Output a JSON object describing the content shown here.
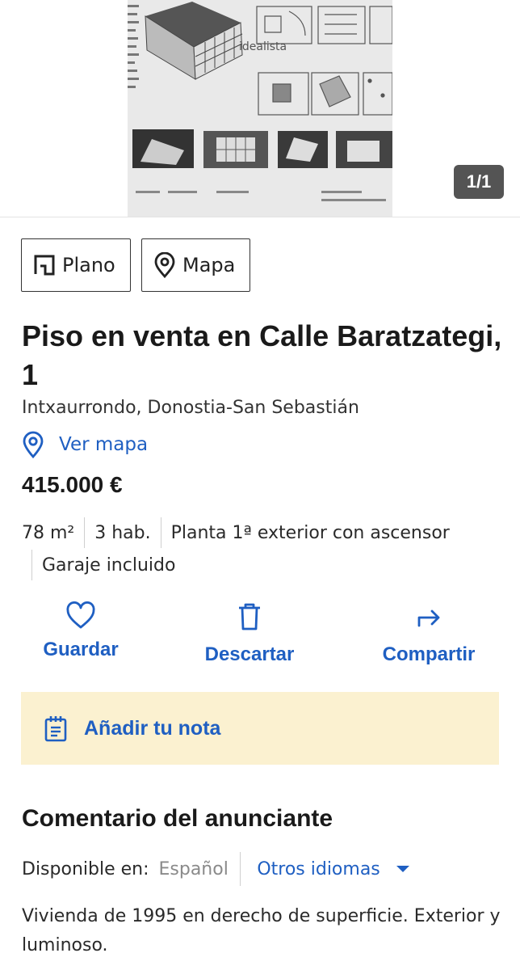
{
  "gallery": {
    "counter": "1/1",
    "watermark": "idealista"
  },
  "chips": {
    "plano": "Plano",
    "mapa": "Mapa"
  },
  "listing": {
    "title": "Piso en venta en Calle Baratzategi, 1",
    "location": "Intxaurrondo, Donostia-San Sebastián",
    "ver_mapa": "Ver mapa",
    "price": "415.000 €",
    "features": [
      "78 m²",
      "3 hab.",
      "Planta 1ª exterior con ascensor",
      "Garaje incluido"
    ]
  },
  "actions": {
    "guardar": "Guardar",
    "descartar": "Descartar",
    "compartir": "Compartir"
  },
  "note": {
    "label": "Añadir tu nota"
  },
  "comment": {
    "title": "Comentario del anunciante",
    "available_label": "Disponible en:",
    "current_language": "Español",
    "other_languages": "Otros idiomas",
    "description": "Vivienda de 1995 en derecho de superficie. Exterior y luminoso."
  },
  "colors": {
    "accent": "#1f5fc2",
    "note_background": "#fbf1d0",
    "text": "#1a1a1a"
  },
  "icons": {
    "plano": "floorplan-icon",
    "mapa": "map-pin-icon",
    "guardar": "heart-icon",
    "descartar": "trash-icon",
    "compartir": "share-arrow-icon",
    "note": "notepad-icon",
    "other_languages": "caret-down-icon"
  }
}
